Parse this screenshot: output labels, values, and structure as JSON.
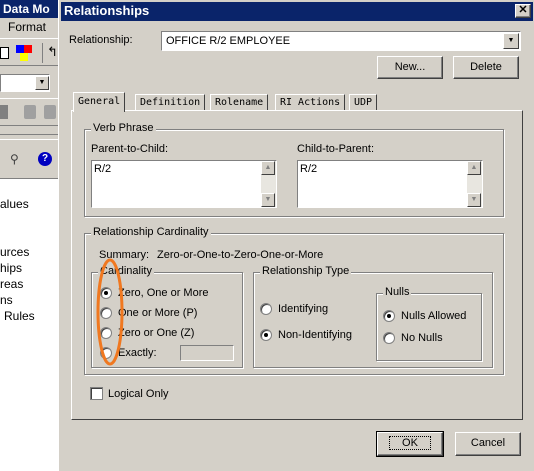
{
  "background_app": {
    "title": "Data Mo",
    "menu_format": "Format",
    "list_items": [
      "alues",
      "urces",
      "hips",
      "reas",
      "ns",
      "Rules"
    ]
  },
  "dialog": {
    "title": "Relationships",
    "relationship_label": "Relationship:",
    "relationship_value": "OFFICE R/2 EMPLOYEE",
    "new_button": "New...",
    "delete_button": "Delete",
    "tabs": [
      "General",
      "Definition",
      "Rolename",
      "RI Actions",
      "UDP"
    ],
    "verb_phrase": {
      "legend": "Verb Phrase",
      "parent_label": "Parent-to-Child:",
      "parent_value": "R/2",
      "child_label": "Child-to-Parent:",
      "child_value": "R/2"
    },
    "cardinality_group": {
      "legend": "Relationship Cardinality",
      "summary_label": "Summary:",
      "summary_value": "Zero-or-One-to-Zero-One-or-More",
      "cardinality_legend": "Cardinality",
      "options": [
        "Zero, One or More",
        "One or More (P)",
        "Zero or One (Z)",
        "Exactly:"
      ],
      "selected": "Zero, One or More",
      "exactly_value": ""
    },
    "relationship_type": {
      "legend": "Relationship Type",
      "identifying": "Identifying",
      "non_identifying": "Non-Identifying",
      "selected": "Non-Identifying",
      "nulls_legend": "Nulls",
      "nulls_allowed": "Nulls Allowed",
      "no_nulls": "No Nulls",
      "nulls_selected": "Nulls Allowed"
    },
    "logical_only": "Logical Only",
    "ok_button": "OK",
    "cancel_button": "Cancel",
    "annotation_color": "#f07820"
  }
}
